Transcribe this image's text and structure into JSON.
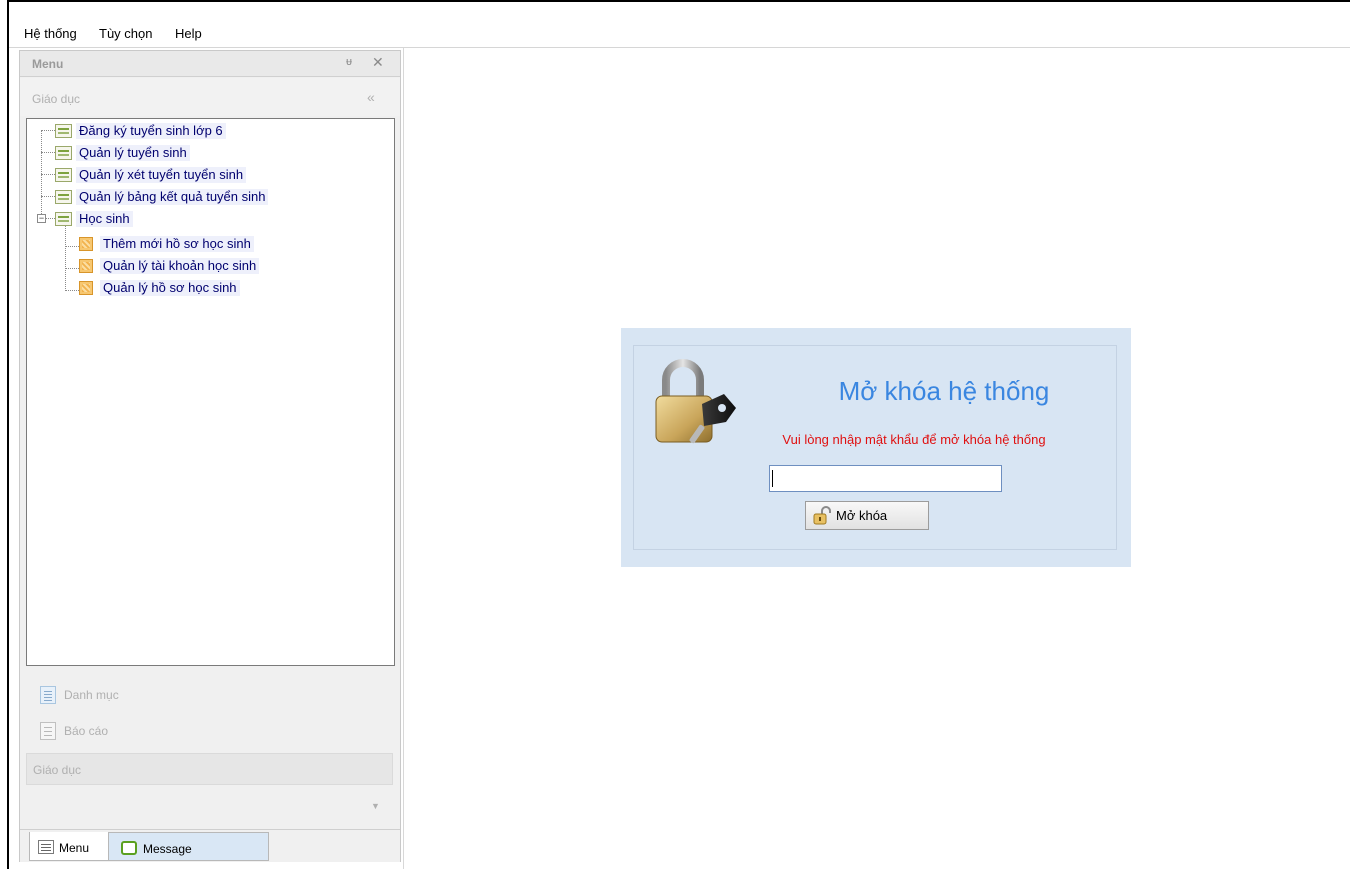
{
  "menubar": {
    "items": [
      {
        "label": "Hệ thống"
      },
      {
        "label": "Tùy chọn"
      },
      {
        "label": "Help"
      }
    ]
  },
  "dock": {
    "title": "Menu",
    "pin_glyph": "ᵾ",
    "close_glyph": "✕",
    "group_header": "Giáo dục",
    "collapse_glyph": "«",
    "tree": {
      "items": [
        {
          "label": "Đăng ký tuyển sinh lớp 6",
          "icon": "document-icon"
        },
        {
          "label": "Quản lý tuyển sinh",
          "icon": "document-icon"
        },
        {
          "label": "Quản lý xét tuyển tuyển sinh",
          "icon": "document-icon"
        },
        {
          "label": "Quản lý bảng kết quả tuyển sinh",
          "icon": "document-icon"
        },
        {
          "label": "Học sinh",
          "icon": "document-icon",
          "expanded": true,
          "children": [
            {
              "label": "Thêm mới hồ sơ học sinh",
              "icon": "student-icon"
            },
            {
              "label": "Quản lý tài khoản học sinh",
              "icon": "student-icon"
            },
            {
              "label": "Quản lý hồ sơ học sinh",
              "icon": "student-icon"
            }
          ]
        }
      ]
    },
    "sections": [
      {
        "label": "Danh mục",
        "icon": "list-icon"
      },
      {
        "label": "Báo cáo",
        "icon": "report-icon"
      }
    ],
    "group_footer": "Giáo dục",
    "overflow_glyph": "▼",
    "tabs": [
      {
        "label": "Menu",
        "icon": "menu-tab-icon",
        "active": true
      },
      {
        "label": "Message",
        "icon": "message-tab-icon",
        "active": false
      }
    ]
  },
  "lock": {
    "title": "Mở khóa hệ thống",
    "message": "Vui lòng nhập mật khẩu để mở khóa hệ thống",
    "password_value": "",
    "button_label": "Mở khóa",
    "colors": {
      "panel_bg": "#d8e5f3",
      "title": "#3a86e0",
      "message": "#e01010"
    }
  }
}
